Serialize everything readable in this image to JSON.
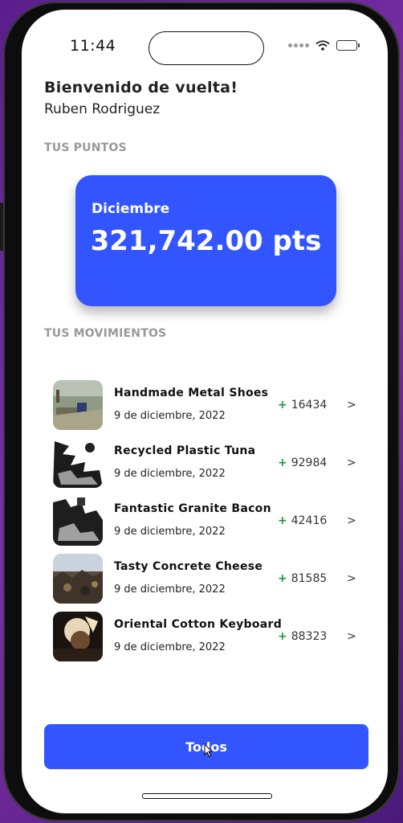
{
  "status_bar": {
    "time": "11:44",
    "icons": [
      "signal-dots-icon",
      "wifi-icon",
      "battery-icon"
    ]
  },
  "header": {
    "greeting": "Bienvenido de vuelta!",
    "user_name": "Ruben Rodriguez"
  },
  "points": {
    "section_title": "TUS PUNTOS",
    "month": "Diciembre",
    "value": "321,742.00 pts",
    "card_color": "#3355ff"
  },
  "movements": {
    "section_title": "TUS MOVIMIENTOS",
    "items": [
      {
        "title": "Handmade Metal Shoes",
        "date": "9 de diciembre, 2022",
        "points": "16434",
        "sign": "+"
      },
      {
        "title": "Recycled Plastic Tuna",
        "date": "9 de diciembre, 2022",
        "points": "92984",
        "sign": "+"
      },
      {
        "title": "Fantastic Granite Bacon",
        "date": "9 de diciembre, 2022",
        "points": "42416",
        "sign": "+"
      },
      {
        "title": "Tasty Concrete Cheese",
        "date": "9 de diciembre, 2022",
        "points": "81585",
        "sign": "+"
      },
      {
        "title": "Oriental Cotton Keyboard",
        "date": "9 de diciembre, 2022",
        "points": "88323",
        "sign": "+"
      }
    ],
    "chevron": ">",
    "positive_color": "#1a9b3a"
  },
  "actions": {
    "all_label": "Todos",
    "button_color": "#3355ff"
  }
}
